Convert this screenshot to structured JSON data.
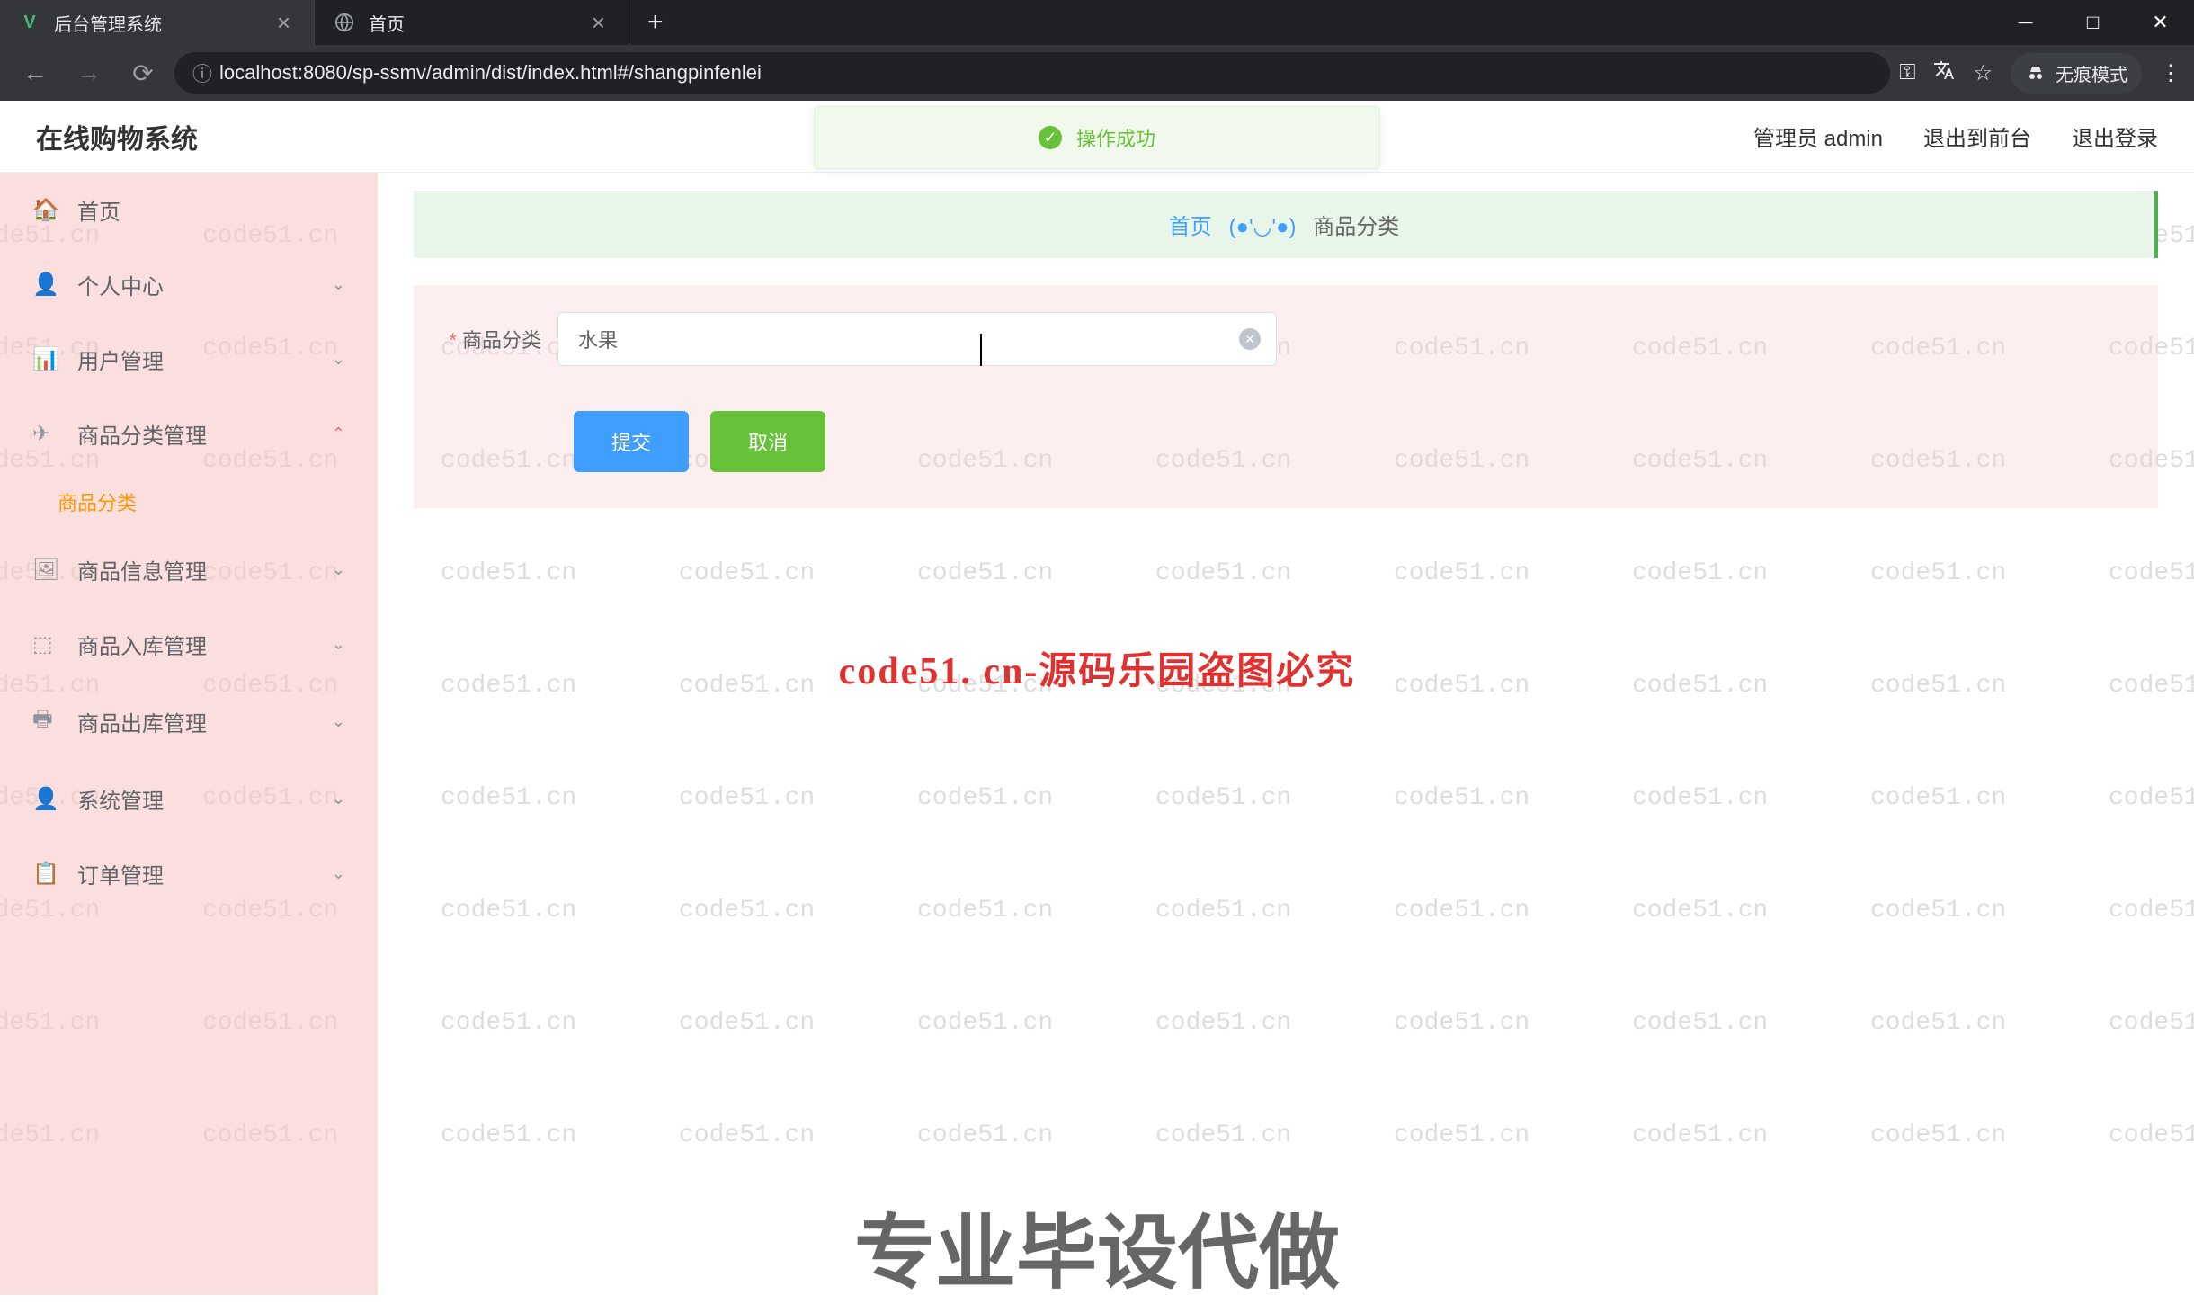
{
  "browser": {
    "tabs": [
      {
        "title": "后台管理系统",
        "active": true,
        "icon": "V"
      },
      {
        "title": "首页",
        "active": false,
        "icon": "globe"
      }
    ],
    "url": "localhost:8080/sp-ssmv/admin/dist/index.html#/shangpinfenlei",
    "incognito_label": "无痕模式"
  },
  "topbar": {
    "brand": "在线购物系统",
    "admin_label": "管理员 admin",
    "logout_front": "退出到前台",
    "logout": "退出登录"
  },
  "notification": {
    "text": "操作成功"
  },
  "sidebar": {
    "items": [
      {
        "label": "首页",
        "icon": "home",
        "expandable": false
      },
      {
        "label": "个人中心",
        "icon": "user",
        "expandable": true
      },
      {
        "label": "用户管理",
        "icon": "users",
        "expandable": true
      },
      {
        "label": "商品分类管理",
        "icon": "send",
        "expandable": true,
        "expanded": true,
        "children": [
          {
            "label": "商品分类"
          }
        ]
      },
      {
        "label": "商品信息管理",
        "icon": "image",
        "expandable": true
      },
      {
        "label": "商品入库管理",
        "icon": "box",
        "expandable": true
      },
      {
        "label": "商品出库管理",
        "icon": "print",
        "expandable": true
      },
      {
        "label": "系统管理",
        "icon": "user",
        "expandable": true
      },
      {
        "label": "订单管理",
        "icon": "clipboard",
        "expandable": true
      }
    ]
  },
  "breadcrumb": {
    "home": "首页",
    "separator": "(●'◡'●)",
    "current": "商品分类"
  },
  "form": {
    "field_label": "商品分类",
    "field_value": "水果",
    "submit_label": "提交",
    "cancel_label": "取消"
  },
  "watermark_text": "code51.cn",
  "overlay": {
    "red": "code51. cn-源码乐园盗图必究",
    "gray": "专业毕设代做"
  }
}
